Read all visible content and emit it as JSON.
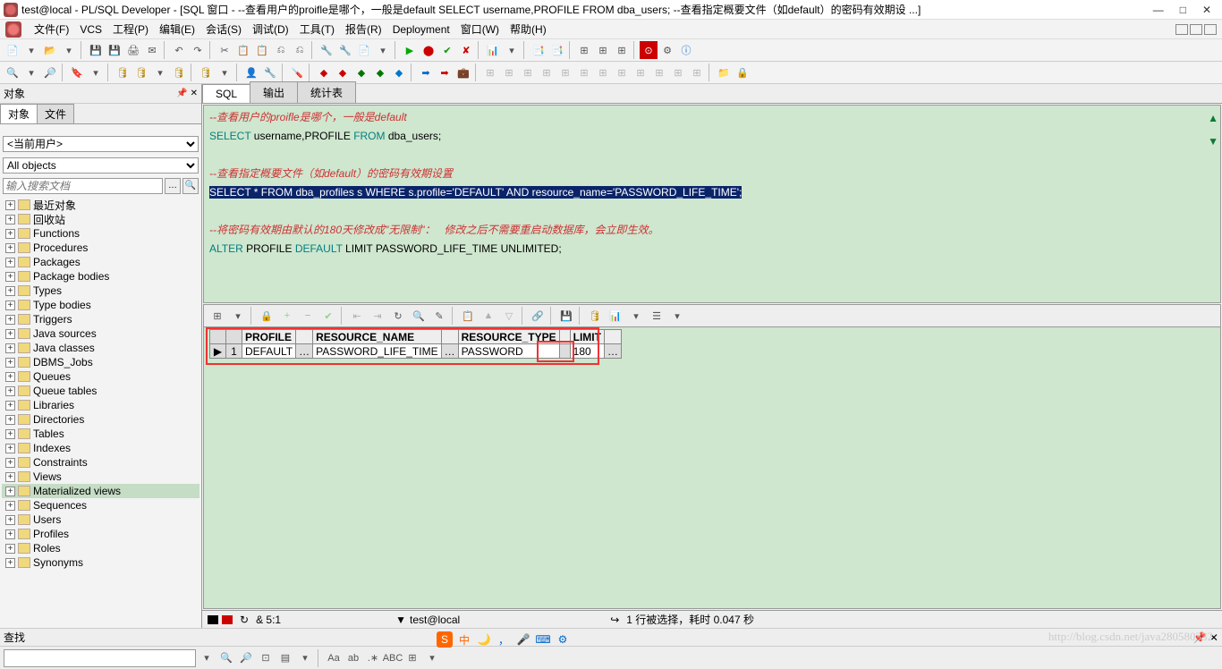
{
  "title": "test@local - PL/SQL Developer - [SQL 窗口 - --查看用户的proifle是哪个，一般是default SELECT username,PROFILE FROM dba_users; --查看指定概要文件（如default）的密码有效期设 ...]",
  "menu": [
    "文件(F)",
    "VCS",
    "工程(P)",
    "编辑(E)",
    "会话(S)",
    "调试(D)",
    "工具(T)",
    "报告(R)",
    "Deployment",
    "窗口(W)",
    "帮助(H)"
  ],
  "objpanel": {
    "header": "对象",
    "tabs": [
      "对象",
      "文件"
    ],
    "user_select": "<当前用户>",
    "filter_select": "All objects",
    "search_placeholder": "输入搜索文档",
    "tree": [
      "最近对象",
      "回收站",
      "Functions",
      "Procedures",
      "Packages",
      "Package bodies",
      "Types",
      "Type bodies",
      "Triggers",
      "Java sources",
      "Java classes",
      "DBMS_Jobs",
      "Queues",
      "Queue tables",
      "Libraries",
      "Directories",
      "Tables",
      "Indexes",
      "Constraints",
      "Views",
      "Materialized views",
      "Sequences",
      "Users",
      "Profiles",
      "Roles",
      "Synonyms"
    ],
    "selected_index": 20
  },
  "rtabs": [
    "SQL",
    "输出",
    "统计表"
  ],
  "editor": {
    "l1": "--查看用户的proifle是哪个，一般是default",
    "l2a": "SELECT",
    "l2b": " username,PROFILE ",
    "l2c": "FROM",
    "l2d": " dba_users;",
    "l3": "",
    "l4": "--查看指定概要文件（如default）的密码有效期设置",
    "l5": "SELECT * FROM dba_profiles s WHERE s.profile='DEFAULT' AND resource_name='PASSWORD_LIFE_TIME';",
    "l6": "",
    "l7": "--将密码有效期由默认的180天修改成\"无限制\"：   修改之后不需要重启动数据库，会立即生效。",
    "l8a": "ALTER",
    "l8b": " PROFILE ",
    "l8c": "DEFAULT",
    "l8d": " LIMIT PASSWORD_LIFE_TIME UNLIMITED;"
  },
  "grid": {
    "headers": [
      "",
      "",
      "PROFILE",
      "",
      "RESOURCE_NAME",
      "",
      "RESOURCE_TYPE",
      "",
      "LIMIT",
      ""
    ],
    "row": [
      "▶",
      "1",
      "DEFAULT",
      "…",
      "PASSWORD_LIFE_TIME",
      "…",
      "PASSWORD",
      "",
      "180",
      "…"
    ]
  },
  "status": {
    "pos": "& 5:1",
    "conn": "test@local",
    "msg": "1 行被选择，耗时 0.047 秒"
  },
  "find_label": "查找",
  "watermark": "http://blog.csdn.net/java280580332"
}
